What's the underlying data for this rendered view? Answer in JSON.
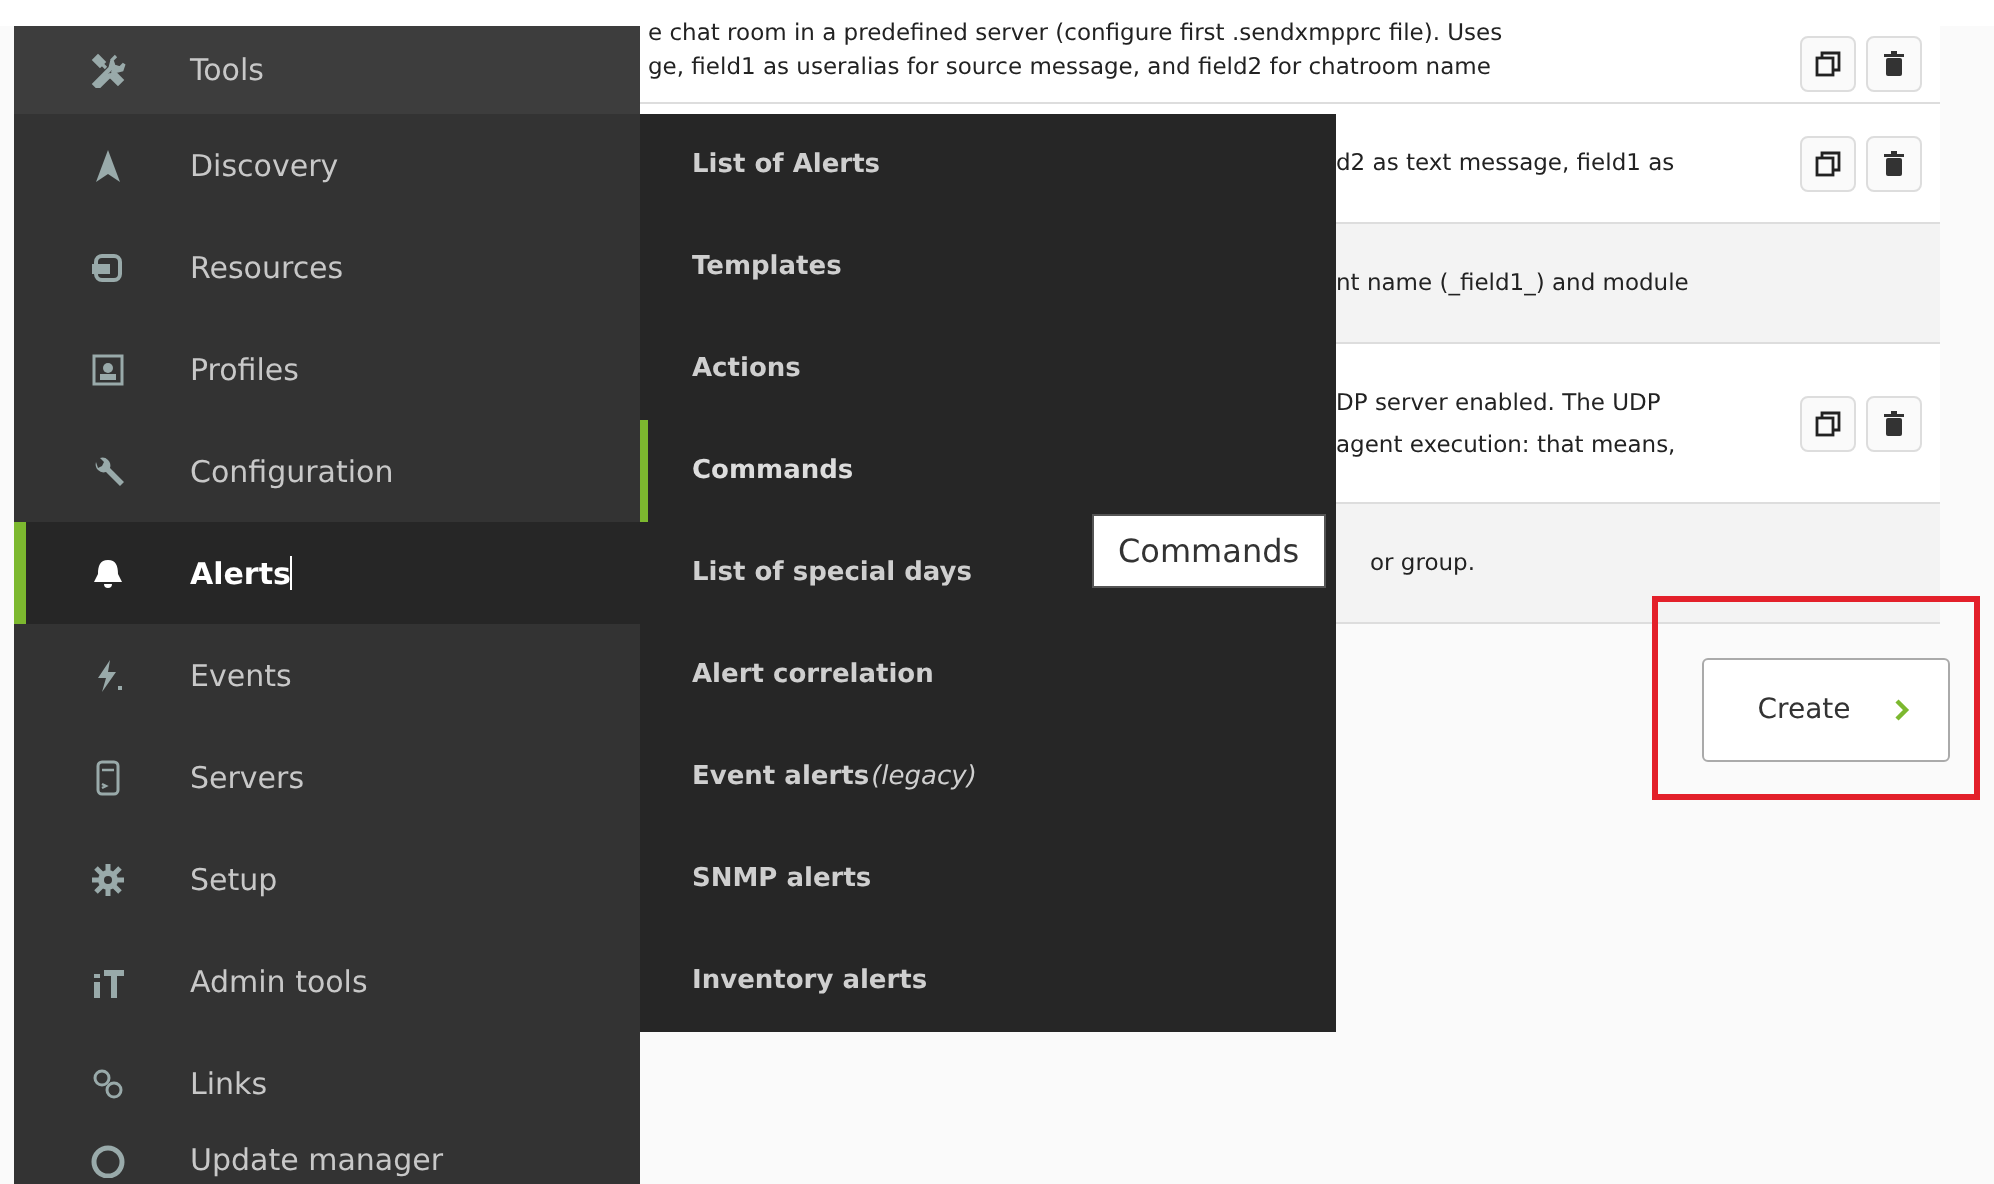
{
  "sidebar": {
    "items": [
      {
        "label": "Tools",
        "selected": false
      },
      {
        "label": "Discovery",
        "selected": false
      },
      {
        "label": "Resources",
        "selected": false
      },
      {
        "label": "Profiles",
        "selected": false
      },
      {
        "label": "Configuration",
        "selected": false
      },
      {
        "label": "Alerts",
        "selected": true
      },
      {
        "label": "Events",
        "selected": false
      },
      {
        "label": "Servers",
        "selected": false
      },
      {
        "label": "Setup",
        "selected": false
      },
      {
        "label": "Admin tools",
        "selected": false
      },
      {
        "label": "Links",
        "selected": false
      },
      {
        "label": "Update manager",
        "selected": false
      }
    ]
  },
  "submenu": {
    "items": [
      {
        "label": "List of Alerts",
        "selected": false
      },
      {
        "label": "Templates",
        "selected": false
      },
      {
        "label": "Actions",
        "selected": false
      },
      {
        "label": "Commands",
        "selected": true
      },
      {
        "label": "List of special days",
        "selected": false
      },
      {
        "label": "Alert correlation",
        "selected": false
      },
      {
        "label": "Event alerts",
        "note": "(legacy)",
        "selected": false
      },
      {
        "label": "SNMP alerts",
        "selected": false
      },
      {
        "label": "Inventory alerts",
        "selected": false
      }
    ]
  },
  "tooltip": "Commands",
  "table": {
    "rows": [
      {
        "kind": "open",
        "shaded": false,
        "lines": [
          "e chat room in a predefined server (configure first .sendxmpprc file). Uses",
          "ge, field1 as useralias for source message, and field2 for chatroom name"
        ],
        "actions": true
      },
      {
        "kind": "covered",
        "shaded": false,
        "lines": [
          "d2 as text message, field1 as"
        ],
        "actions": true
      },
      {
        "kind": "covered",
        "shaded": true,
        "lines": [
          "nt name (_field1_) and module"
        ],
        "actions": false
      },
      {
        "kind": "covered",
        "shaded": false,
        "lines": [
          "DP server enabled. The UDP",
          "agent execution: that means,"
        ],
        "actions": true
      },
      {
        "kind": "tooltip",
        "shaded": true,
        "lines": [
          "or group."
        ],
        "actions": false
      }
    ]
  },
  "create_button": {
    "label": "Create",
    "highlighted": true
  }
}
